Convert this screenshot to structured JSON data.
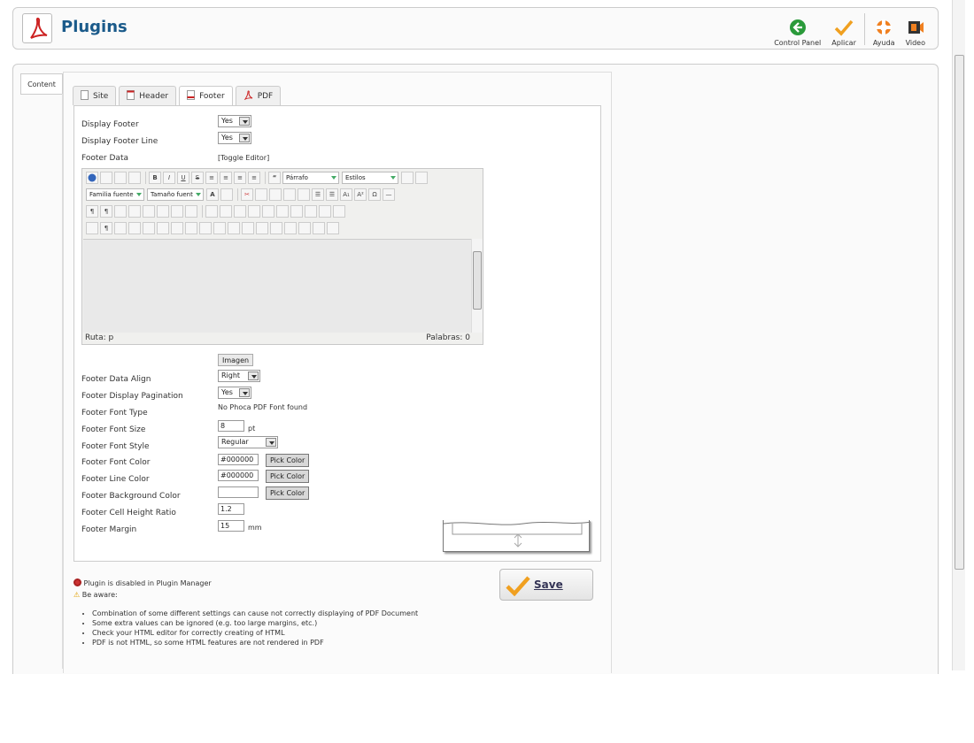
{
  "header": {
    "title": "Plugins",
    "toolbar": [
      {
        "label": "Control Panel",
        "icon": "back-arrow-icon"
      },
      {
        "label": "Aplicar",
        "icon": "checkmark-icon"
      },
      {
        "label": "Ayuda",
        "icon": "help-icon"
      },
      {
        "label": "Video",
        "icon": "video-icon"
      }
    ]
  },
  "sidebar": {
    "content_tab": "Content"
  },
  "tabs": [
    "Site",
    "Header",
    "Footer",
    "PDF"
  ],
  "active_tab": "Footer",
  "fields": {
    "display_footer": {
      "label": "Display Footer",
      "value": "Yes"
    },
    "display_footer_line": {
      "label": "Display Footer Line",
      "value": "Yes"
    },
    "footer_data": {
      "label": "Footer Data",
      "toggle": "[Toggle Editor]"
    },
    "footer_data_align": {
      "label": "Footer Data Align",
      "value": "Right"
    },
    "footer_display_pagination": {
      "label": "Footer Display Pagination",
      "value": "Yes"
    },
    "footer_font_type": {
      "label": "Footer Font Type",
      "value": "No Phoca PDF Font found"
    },
    "footer_font_size": {
      "label": "Footer Font Size",
      "value": "8",
      "unit": "pt"
    },
    "footer_font_style": {
      "label": "Footer Font Style",
      "value": "Regular"
    },
    "footer_font_color": {
      "label": "Footer Font Color",
      "value": "#000000",
      "button": "Pick Color"
    },
    "footer_line_color": {
      "label": "Footer Line Color",
      "value": "#000000",
      "button": "Pick Color"
    },
    "footer_background_color": {
      "label": "Footer Background Color",
      "value": "",
      "button": "Pick Color"
    },
    "footer_cell_height_ratio": {
      "label": "Footer Cell Height Ratio",
      "value": "1.2"
    },
    "footer_margin": {
      "label": "Footer Margin",
      "value": "15",
      "unit": "mm"
    }
  },
  "editor": {
    "paragraph_select": "Párrafo",
    "styles_select": "Estilos",
    "font_family_select": "Familia fuente",
    "font_size_select": "Tamaño fuent",
    "path": "Ruta: p",
    "words": "Palabras: 0",
    "image_button": "Imagen"
  },
  "notes": {
    "disabled": "Plugin is disabled in Plugin Manager",
    "be_aware": "Be aware:",
    "bullets": [
      "Combination of some different settings can cause not correctly displaying of PDF Document",
      "Some extra values can be ignored (e.g. too large margins, etc.)",
      "Check your HTML editor for correctly creating of HTML",
      "PDF is not HTML, so some HTML features are not rendered in PDF"
    ]
  },
  "save_button": "Save",
  "colors": {
    "title_blue": "#1a5a8a",
    "pdf_red": "#cc2222",
    "accent_orange": "#f0a020",
    "control_panel_green": "#2a9a3a"
  }
}
